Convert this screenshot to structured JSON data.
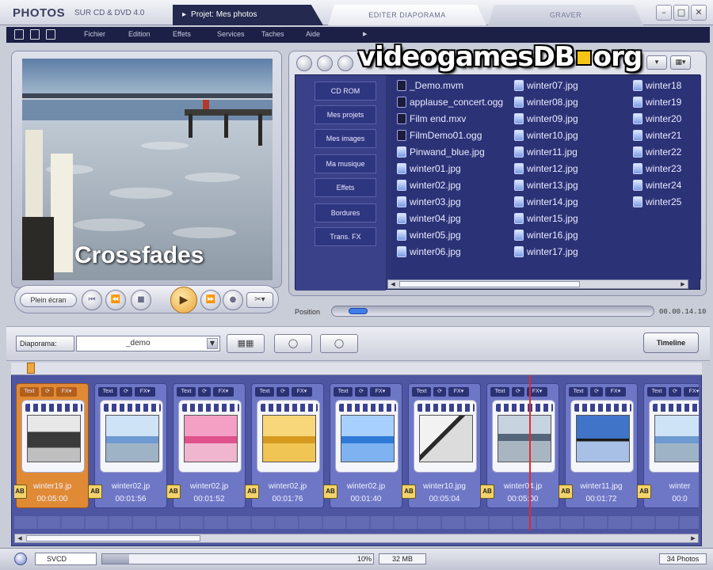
{
  "app": {
    "brand": "PHOTOS",
    "brand_sub": "SUR CD & DVD 4.0",
    "project_tab": "Projet: Mes photos",
    "tabs": [
      {
        "label": "EDITER DIAPORAMA"
      },
      {
        "label": "GRAVER"
      }
    ],
    "window_buttons": [
      "–",
      "□",
      "✕"
    ]
  },
  "menu": {
    "items": [
      "Fichier",
      "Edition",
      "Effets",
      "Services",
      "Taches",
      "Aide"
    ],
    "more": "▸"
  },
  "watermark": {
    "left": "videogamesDB",
    "right": "org"
  },
  "preview": {
    "caption": "Crossfades"
  },
  "player": {
    "fullscreen_label": "Plein écran",
    "buttons": [
      "⏮",
      "⏪",
      "■",
      "▶",
      "⏩",
      "●"
    ],
    "cut_label": "✂▾"
  },
  "browser": {
    "nav": [
      "CD ROM",
      "Mes projets",
      "Mes images",
      "Ma musique",
      "Effets",
      "Bordures",
      "Trans. FX"
    ],
    "files": [
      {
        "name": "_Demo.mvm",
        "type": "media"
      },
      {
        "name": "applause_concert.ogg",
        "type": "media"
      },
      {
        "name": "Film end.mxv",
        "type": "media"
      },
      {
        "name": "FilmDemo01.ogg",
        "type": "media"
      },
      {
        "name": "Pinwand_blue.jpg",
        "type": "img"
      },
      {
        "name": "winter01.jpg",
        "type": "img"
      },
      {
        "name": "winter02.jpg",
        "type": "img"
      },
      {
        "name": "winter03.jpg",
        "type": "img"
      },
      {
        "name": "winter04.jpg",
        "type": "img"
      },
      {
        "name": "winter05.jpg",
        "type": "img"
      },
      {
        "name": "winter06.jpg",
        "type": "img"
      },
      {
        "name": "winter07.jpg",
        "type": "img"
      },
      {
        "name": "winter08.jpg",
        "type": "img"
      },
      {
        "name": "winter09.jpg",
        "type": "img"
      },
      {
        "name": "winter10.jpg",
        "type": "img"
      },
      {
        "name": "winter11.jpg",
        "type": "img"
      },
      {
        "name": "winter12.jpg",
        "type": "img"
      },
      {
        "name": "winter13.jpg",
        "type": "img"
      },
      {
        "name": "winter14.jpg",
        "type": "img"
      },
      {
        "name": "winter15.jpg",
        "type": "img"
      },
      {
        "name": "winter16.jpg",
        "type": "img"
      },
      {
        "name": "winter17.jpg",
        "type": "img"
      },
      {
        "name": "winter18",
        "type": "img"
      },
      {
        "name": "winter19",
        "type": "img"
      },
      {
        "name": "winter20",
        "type": "img"
      },
      {
        "name": "winter21",
        "type": "img"
      },
      {
        "name": "winter22",
        "type": "img"
      },
      {
        "name": "winter23",
        "type": "img"
      },
      {
        "name": "winter24",
        "type": "img"
      },
      {
        "name": "winter25",
        "type": "img"
      }
    ]
  },
  "position": {
    "label": "Position",
    "time": "00.00.14.10",
    "value_fraction": 0.05
  },
  "toolbar": {
    "diaporama_label": "Diaporama:",
    "diaporama_value": "_demo",
    "timeline_label": "Timeline"
  },
  "storyboard": {
    "clips": [
      {
        "name": "winter19.jp",
        "duration": "00:05:00",
        "selected": true,
        "thumb": "thumb-bw"
      },
      {
        "name": "winter02.jp",
        "duration": "00:01:56",
        "selected": false,
        "thumb": "thumb-sky"
      },
      {
        "name": "winter02.jp",
        "duration": "00:01:52",
        "selected": false,
        "thumb": "thumb-pink"
      },
      {
        "name": "winter02.jp",
        "duration": "00:01:76",
        "selected": false,
        "thumb": "thumb-gold"
      },
      {
        "name": "winter02.jp",
        "duration": "00:01:40",
        "selected": false,
        "thumb": "thumb-blue"
      },
      {
        "name": "winter10.jpg",
        "duration": "00:05:04",
        "selected": false,
        "thumb": "thumb-tree"
      },
      {
        "name": "winter04.jp",
        "duration": "00:05:00",
        "selected": false,
        "thumb": "thumb-pier"
      },
      {
        "name": "winter11.jpg",
        "duration": "00:01:72",
        "selected": false,
        "thumb": "thumb-branch"
      },
      {
        "name": "winter",
        "duration": "00:0",
        "selected": false,
        "thumb": "thumb-sky"
      }
    ],
    "clip_tools": [
      "Text",
      "⟳",
      "FX▾"
    ],
    "transition_label": "AB"
  },
  "status": {
    "format": "SVCD",
    "disk_percent": "10%",
    "disk_fraction": 0.1,
    "disk_size": "32 MB",
    "photo_count": "34 Photos"
  }
}
